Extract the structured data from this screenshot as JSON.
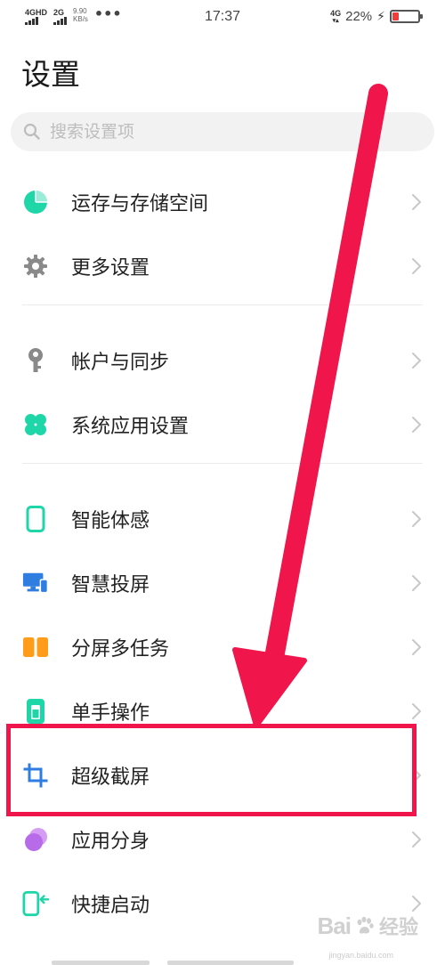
{
  "status_bar": {
    "sim1_label": "4GHD",
    "sim2_label": "2G",
    "speed_value": "9.90",
    "speed_unit": "KB/s",
    "more_dots": "•••",
    "time": "17:37",
    "network_label": "4G",
    "battery_percent": "22%",
    "battery_level": 0.22,
    "battery_color": "#f23b3b",
    "charging_icon": "bolt-icon"
  },
  "page": {
    "title": "设置"
  },
  "search": {
    "placeholder": "搜索设置项",
    "icon": "search-icon"
  },
  "groups": [
    {
      "items": [
        {
          "label": "运存与存储空间",
          "icon": "pie-chart-icon",
          "color": "#1fd6a8"
        },
        {
          "label": "更多设置",
          "icon": "gear-icon",
          "color": "#8a8a8a"
        }
      ]
    },
    {
      "items": [
        {
          "label": "帐户与同步",
          "icon": "key-icon",
          "color": "#8a8a8a"
        },
        {
          "label": "系统应用设置",
          "icon": "clover-icon",
          "color": "#1fd6a8"
        }
      ]
    },
    {
      "items": [
        {
          "label": "智能体感",
          "icon": "phone-outline-icon",
          "color": "#1fd6a8"
        },
        {
          "label": "智慧投屏",
          "icon": "screen-cast-icon",
          "color": "#2f7de1"
        },
        {
          "label": "分屏多任务",
          "icon": "split-screen-icon",
          "color": "#ff9d1a"
        },
        {
          "label": "单手操作",
          "icon": "one-hand-icon",
          "color": "#1fd6a8"
        },
        {
          "label": "超级截屏",
          "icon": "crop-icon",
          "color": "#2f7de1"
        },
        {
          "label": "应用分身",
          "icon": "app-clone-icon",
          "color": "#b86be8"
        },
        {
          "label": "快捷启动",
          "icon": "quick-launch-icon",
          "color": "#1fd6a8"
        }
      ]
    }
  ],
  "annotation": {
    "highlight_color": "#f0154a",
    "arrow_color": "#f0154a",
    "highlighted_item": "超级截屏"
  },
  "watermark": {
    "logo": "Bai",
    "logo_suffix": "经验",
    "url": "jingyan.baidu.com"
  }
}
